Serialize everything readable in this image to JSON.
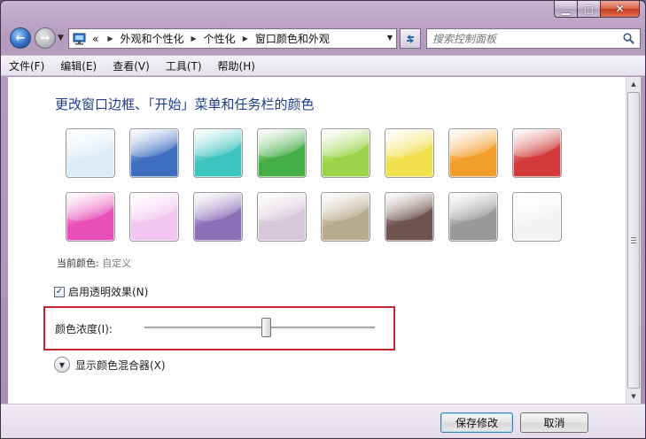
{
  "caption": {
    "minimize": "▁",
    "maximize": "□",
    "close": "✕"
  },
  "nav": {
    "back_glyph": "←",
    "forward_glyph": "→",
    "recent_glyph": "▼",
    "address": {
      "prefix": "«",
      "crumbs": [
        "外观和个性化",
        "个性化",
        "窗口颜色和外观"
      ],
      "separator": "▶"
    },
    "search_placeholder": "搜索控制面板"
  },
  "menu": [
    "文件(F)",
    "编辑(E)",
    "查看(V)",
    "工具(T)",
    "帮助(H)"
  ],
  "heading": "更改窗口边框、「开始」菜单和任务栏的颜色",
  "swatches": [
    [
      "#dcecf8",
      "#3d6ebf",
      "#3dc3c0",
      "#45ad45",
      "#9bd44a",
      "#f2df4e",
      "#f29e2c",
      "#d23a3a"
    ],
    [
      "#e84fb8",
      "#f2c6f0",
      "#8d6fb8",
      "#d6c8d8",
      "#b8aa8c",
      "#6e5250",
      "#9a9a9a",
      "#f4f4f6"
    ]
  ],
  "current_color": {
    "label": "当前颜色:",
    "value": "自定义"
  },
  "transparency": {
    "label": "启用透明效果(N)",
    "checked": true
  },
  "intensity": {
    "label": "颜色浓度(I):",
    "level": 0.53
  },
  "mixer": {
    "label": "显示颜色混合器(X)"
  },
  "buttons": {
    "save": "保存修改",
    "cancel": "取消"
  }
}
